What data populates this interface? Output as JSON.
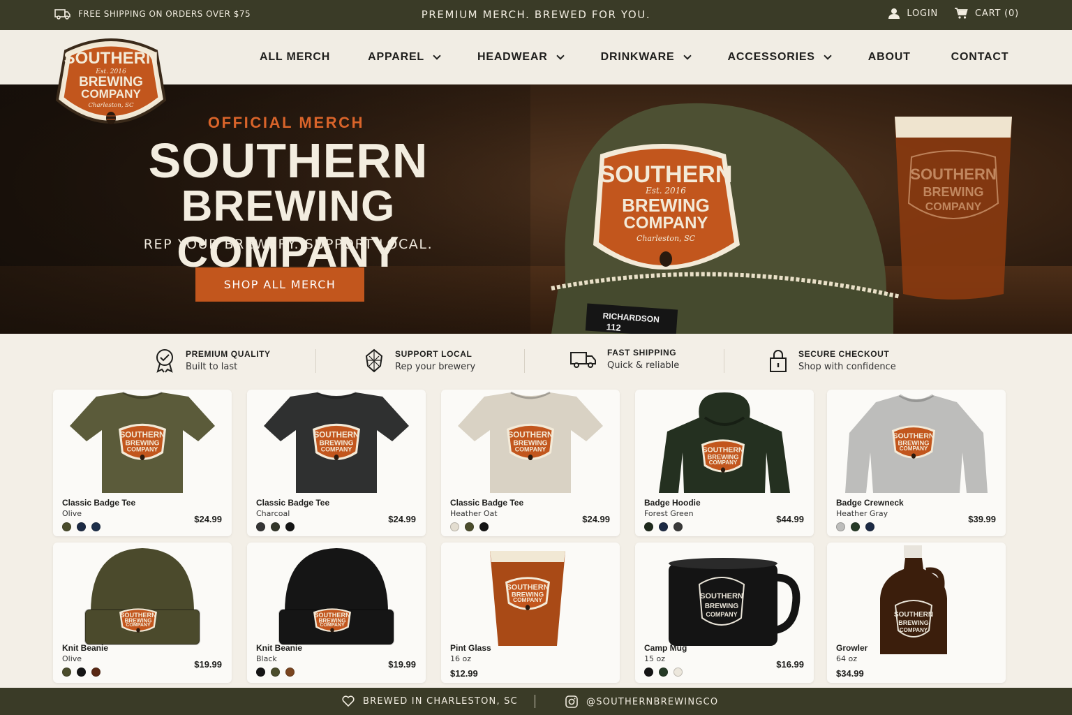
{
  "topbar": {
    "shipping": "FREE SHIPPING ON ORDERS OVER $75",
    "tagline": "PREMIUM MERCH. BREWED FOR YOU.",
    "login": "LOGIN",
    "cart": "CART (0)"
  },
  "logo": {
    "line1": "SOUTHERN",
    "est": "Est. 2016",
    "line2": "BREWING",
    "line3": "COMPANY",
    "city": "Charleston, SC"
  },
  "nav": {
    "items": [
      {
        "label": "ALL MERCH",
        "dropdown": false
      },
      {
        "label": "APPAREL",
        "dropdown": true
      },
      {
        "label": "HEADWEAR",
        "dropdown": true
      },
      {
        "label": "DRINKWARE",
        "dropdown": true
      },
      {
        "label": "ACCESSORIES",
        "dropdown": true
      },
      {
        "label": "ABOUT",
        "dropdown": false
      },
      {
        "label": "CONTACT",
        "dropdown": false
      }
    ]
  },
  "hero": {
    "eyebrow": "OFFICIAL MERCH",
    "title_line1": "SOUTHERN",
    "title_line2": "BREWING COMPANY",
    "subtitle": "REP YOUR BREWERY. SUPPORT LOCAL.",
    "cta": "SHOP ALL MERCH",
    "cap_tag": "RICHARDSON",
    "cap_model": "112"
  },
  "features": [
    {
      "title": "PREMIUM QUALITY",
      "subtitle": "Built to last",
      "icon": "award-ribbon-icon"
    },
    {
      "title": "SUPPORT LOCAL",
      "subtitle": "Rep your brewery",
      "icon": "hop-icon"
    },
    {
      "title": "FAST SHIPPING",
      "subtitle": "Quick & reliable",
      "icon": "truck-icon"
    },
    {
      "title": "SECURE CHECKOUT",
      "subtitle": "Shop with confidence",
      "icon": "lock-icon"
    }
  ],
  "products": [
    {
      "name": "Classic Badge Tee",
      "variant": "Olive",
      "price": "$24.99",
      "kind": "tee",
      "color": "#5b5b3a",
      "swatches": [
        "#4b4d2c",
        "#1c2a44",
        "#1d2f4a"
      ]
    },
    {
      "name": "Classic Badge Tee",
      "variant": "Charcoal",
      "price": "$24.99",
      "kind": "tee",
      "color": "#2f3030",
      "swatches": [
        "#353535",
        "#33362a",
        "#151515"
      ]
    },
    {
      "name": "Classic Badge Tee",
      "variant": "Heather Oat",
      "price": "$24.99",
      "kind": "tee",
      "color": "#d9d2c4",
      "swatches": [
        "#e3ddd0",
        "#4b4d2c",
        "#151515"
      ]
    },
    {
      "name": "Badge Hoodie",
      "variant": "Forest Green",
      "price": "$44.99",
      "kind": "hoodie",
      "color": "#243020",
      "swatches": [
        "#1f2a1c",
        "#1c2a44",
        "#3a3a3a"
      ]
    },
    {
      "name": "Badge Crewneck",
      "variant": "Heather Gray",
      "price": "$39.99",
      "kind": "crew",
      "color": "#bdbdbb",
      "swatches": [
        "#bdbdbb",
        "#263a26",
        "#1c2a44"
      ]
    },
    {
      "name": "Knit Beanie",
      "variant": "Olive",
      "price": "$19.99",
      "kind": "beanie",
      "color": "#4b4a2c",
      "swatches": [
        "#4b4d2c",
        "#151515",
        "#5a2814"
      ]
    },
    {
      "name": "Knit Beanie",
      "variant": "Black",
      "price": "$19.99",
      "kind": "beanie",
      "color": "#151515",
      "swatches": [
        "#151515",
        "#4b4d2c",
        "#7a4520"
      ]
    },
    {
      "name": "Pint Glass",
      "variant": "16 oz",
      "price": "$12.99",
      "kind": "pint",
      "color": "#a94a16",
      "swatches": []
    },
    {
      "name": "Camp Mug",
      "variant": "15 oz",
      "price": "$16.99",
      "kind": "mug",
      "color": "#141414",
      "swatches": [
        "#151515",
        "#263a26",
        "#ece7dc"
      ]
    },
    {
      "name": "Growler",
      "variant": "64 oz",
      "price": "$34.99",
      "kind": "growler",
      "color": "#3b1e0c",
      "swatches": []
    }
  ],
  "footer": {
    "location": "BREWED IN CHARLESTON, SC",
    "social": "@SOUTHERNBREWINGCO"
  },
  "colors": {
    "olive_dark": "#3a3b27",
    "accent_orange": "#c2561d",
    "cream": "#f3efe7"
  }
}
